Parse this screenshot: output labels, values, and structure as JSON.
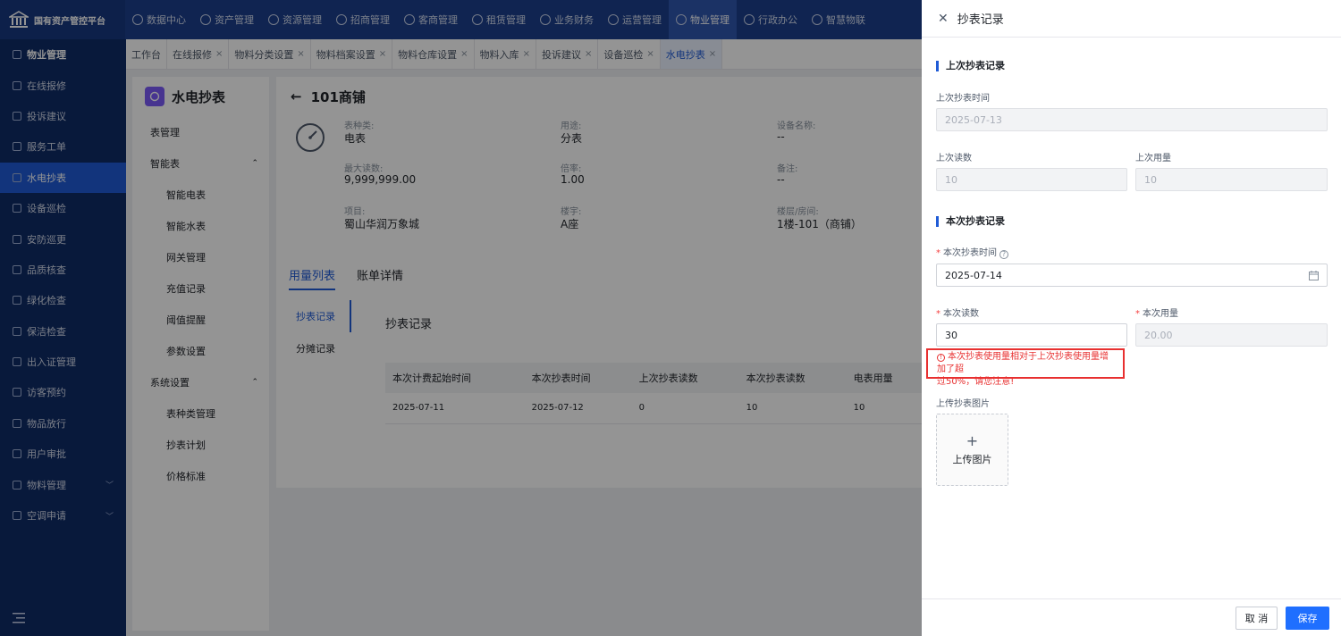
{
  "app": {
    "brand": "国有资产管控平台"
  },
  "topnav": [
    {
      "label": "数据中心",
      "active": false
    },
    {
      "label": "资产管理",
      "active": false
    },
    {
      "label": "资源管理",
      "active": false
    },
    {
      "label": "招商管理",
      "active": false
    },
    {
      "label": "客商管理",
      "active": false
    },
    {
      "label": "租赁管理",
      "active": false
    },
    {
      "label": "业务财务",
      "active": false
    },
    {
      "label": "运营管理",
      "active": false
    },
    {
      "label": "物业管理",
      "active": true
    },
    {
      "label": "行政办公",
      "active": false
    },
    {
      "label": "智慧物联",
      "active": false
    }
  ],
  "sidebar": {
    "items": [
      {
        "label": "物业管理",
        "kind": "head"
      },
      {
        "label": "在线报修"
      },
      {
        "label": "投诉建议"
      },
      {
        "label": "服务工单"
      },
      {
        "label": "水电抄表",
        "active": true
      },
      {
        "label": "设备巡检"
      },
      {
        "label": "安防巡更"
      },
      {
        "label": "品质核查"
      },
      {
        "label": "绿化检查"
      },
      {
        "label": "保洁检查"
      },
      {
        "label": "出入证管理"
      },
      {
        "label": "访客预约"
      },
      {
        "label": "物品放行"
      },
      {
        "label": "用户审批"
      },
      {
        "label": "物料管理",
        "chev": "﹀"
      },
      {
        "label": "空调申请",
        "chev": "﹀"
      }
    ]
  },
  "tabs": [
    {
      "label": "工作台",
      "active": false
    },
    {
      "label": "在线报修",
      "active": false
    },
    {
      "label": "物料分类设置",
      "active": false
    },
    {
      "label": "物料档案设置",
      "active": false
    },
    {
      "label": "物料仓库设置",
      "active": false
    },
    {
      "label": "物料入库",
      "active": false
    },
    {
      "label": "投诉建议",
      "active": false
    },
    {
      "label": "设备巡检",
      "active": false
    },
    {
      "label": "水电抄表",
      "active": true
    }
  ],
  "submenu": {
    "title": "水电抄表",
    "items": [
      {
        "label": "表管理",
        "child": false
      },
      {
        "label": "智能表",
        "child": false,
        "chev": "⌃"
      },
      {
        "label": "智能电表",
        "child": true
      },
      {
        "label": "智能水表",
        "child": true
      },
      {
        "label": "网关管理",
        "child": true
      },
      {
        "label": "充值记录",
        "child": true
      },
      {
        "label": "阈值提醒",
        "child": true
      },
      {
        "label": "参数设置",
        "child": true
      },
      {
        "label": "系统设置",
        "child": false,
        "chev": "⌃"
      },
      {
        "label": "表种类管理",
        "child": true
      },
      {
        "label": "抄表计划",
        "child": true
      },
      {
        "label": "价格标准",
        "child": true
      }
    ]
  },
  "content": {
    "back_arrow": "←",
    "title": "101商铺",
    "info": [
      {
        "label": "表种类:",
        "value": "电表"
      },
      {
        "label": "用途:",
        "value": "分表"
      },
      {
        "label": "设备名称:",
        "value": "--"
      },
      {
        "label": "最大读数:",
        "value": "9,999,999.00"
      },
      {
        "label": "倍率:",
        "value": "1.00"
      },
      {
        "label": "备注:",
        "value": "--"
      },
      {
        "label": "项目:",
        "value": "蜀山华润万象城"
      },
      {
        "label": "楼宇:",
        "value": "A座"
      },
      {
        "label": "楼层/房间:",
        "value": "1楼-101（商铺）"
      }
    ],
    "tabs": [
      {
        "label": "用量列表",
        "active": true
      },
      {
        "label": "账单详情",
        "active": false
      }
    ],
    "vtabs": [
      {
        "label": "抄表记录",
        "active": true
      },
      {
        "label": "分摊记录",
        "active": false
      }
    ],
    "panel_title": "抄表记录",
    "table": {
      "headers": [
        "本次计费起始时间",
        "本次抄表时间",
        "上次抄表读数",
        "本次抄表读数",
        "电表用量"
      ],
      "rows": [
        [
          "2025-07-11",
          "2025-07-12",
          "0",
          "10",
          "10"
        ]
      ]
    }
  },
  "drawer": {
    "title": "抄表记录",
    "last_section": "上次抄表记录",
    "last_time_label": "上次抄表时间",
    "last_time_value": "2025-07-13",
    "last_reading_label": "上次读数",
    "last_reading_value": "10",
    "last_usage_label": "上次用量",
    "last_usage_value": "10",
    "current_section": "本次抄表记录",
    "current_time_label": "本次抄表时间",
    "current_time_value": "2025-07-14",
    "current_reading_label": "本次读数",
    "current_reading_value": "30",
    "current_usage_label": "本次用量",
    "current_usage_value": "20.00",
    "warning_line1": "本次抄表使用量相对于上次抄表使用量增加了超",
    "warning_line2": "过50%，请您注意!",
    "upload_label": "上传抄表图片",
    "upload_button": "上传图片",
    "cancel": "取 消",
    "save": "保存"
  }
}
